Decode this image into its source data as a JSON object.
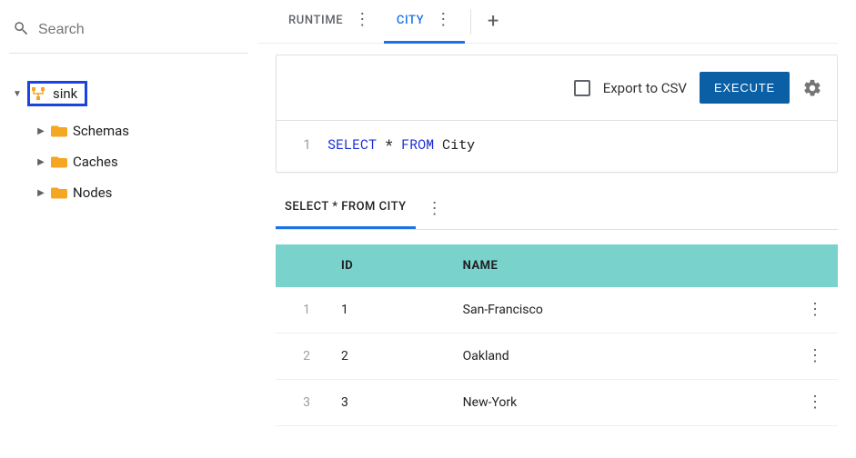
{
  "search": {
    "placeholder": "Search"
  },
  "tree": {
    "root": {
      "label": "sink"
    },
    "children": [
      {
        "label": "Schemas"
      },
      {
        "label": "Caches"
      },
      {
        "label": "Nodes"
      }
    ]
  },
  "tabs": [
    {
      "label": "RUNTIME",
      "active": false
    },
    {
      "label": "CITY",
      "active": true
    }
  ],
  "toolbar": {
    "export_label": "Export to CSV",
    "execute_label": "EXECUTE"
  },
  "editor": {
    "line_number": "1",
    "tokens": {
      "select": "SELECT",
      "star": "*",
      "from": "FROM",
      "table": "City"
    }
  },
  "results": {
    "tab_label": "SELECT * FROM CITY",
    "columns": {
      "id": "ID",
      "name": "NAME"
    },
    "rows": [
      {
        "n": "1",
        "id": "1",
        "name": "San-Francisco"
      },
      {
        "n": "2",
        "id": "2",
        "name": "Oakland"
      },
      {
        "n": "3",
        "id": "3",
        "name": "New-York"
      }
    ]
  }
}
